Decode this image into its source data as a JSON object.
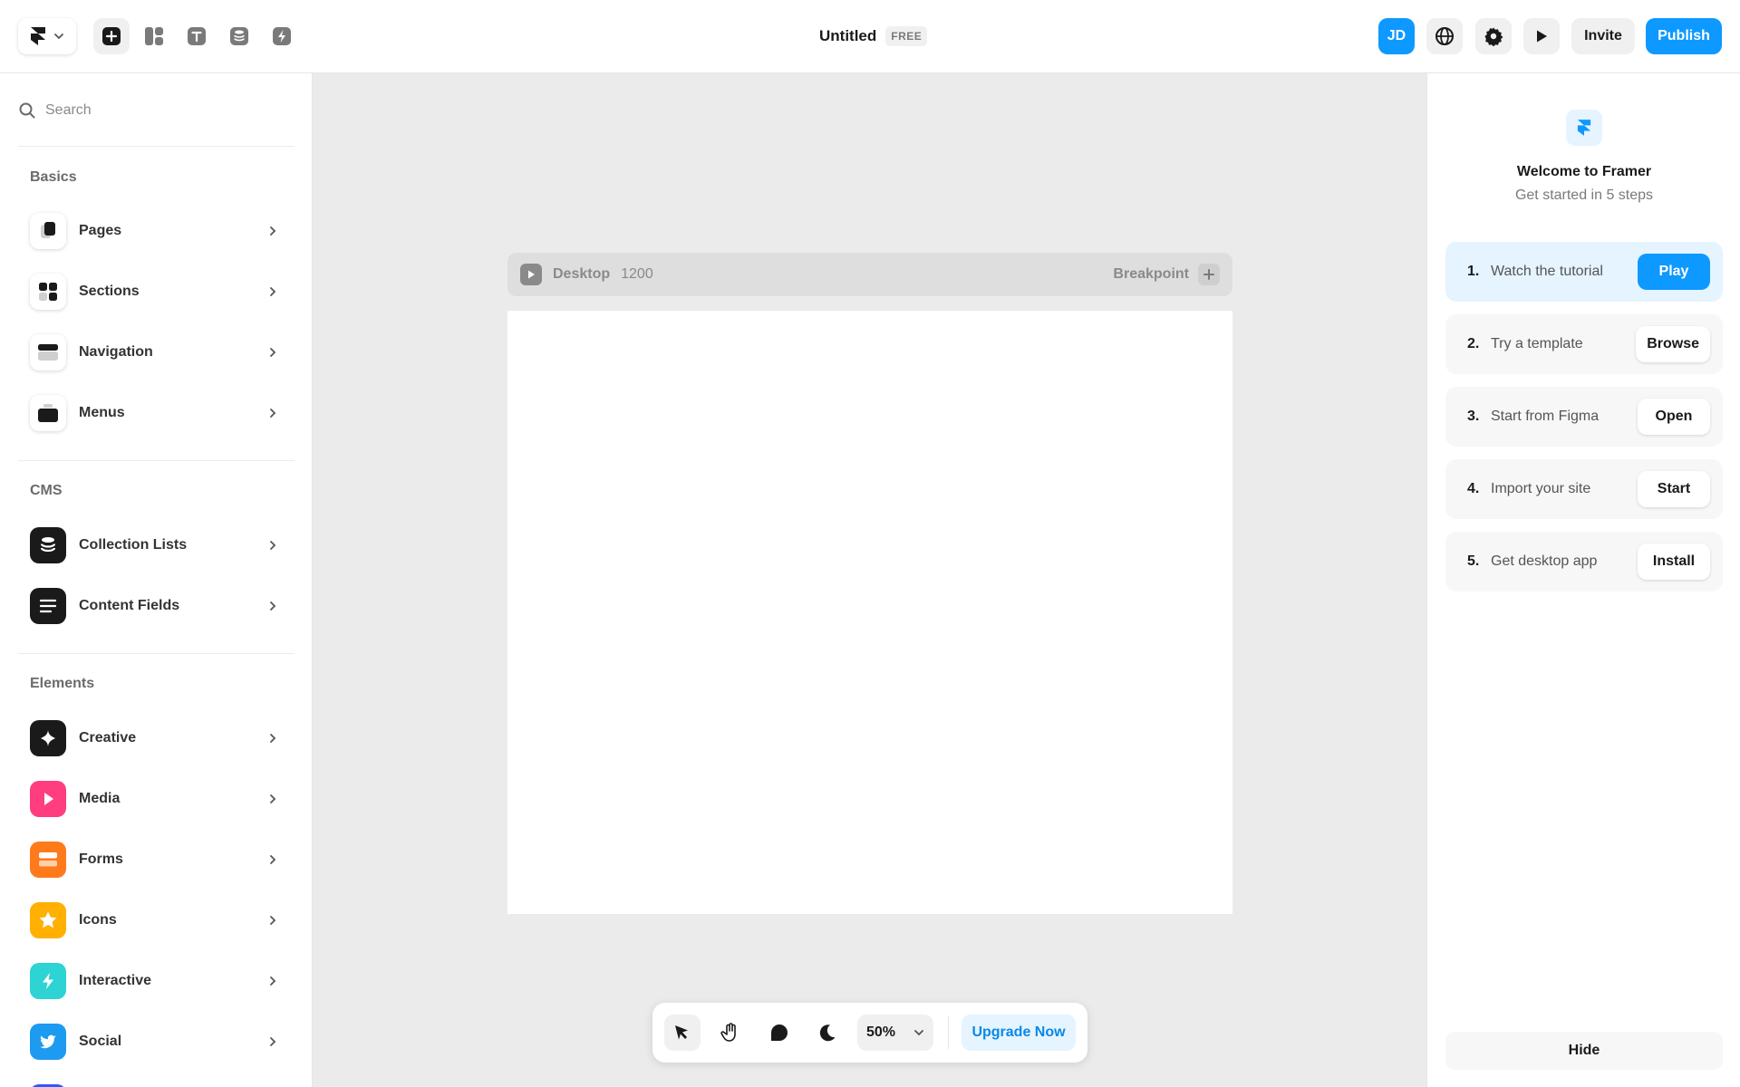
{
  "topbar": {
    "tools": [
      {
        "icon": "plus-icon"
      },
      {
        "icon": "layout-icon"
      },
      {
        "icon": "text-icon"
      },
      {
        "icon": "database-icon"
      },
      {
        "icon": "bolt-icon"
      }
    ],
    "doc_name": "Untitled",
    "plan_badge": "FREE",
    "avatar_initials": "JD",
    "invite_label": "Invite",
    "publish_label": "Publish"
  },
  "sidebar": {
    "search_placeholder": "Search",
    "basics_label": "Basics",
    "basics": [
      {
        "label": "Pages",
        "icon": "pages-icon"
      },
      {
        "label": "Sections",
        "icon": "sections-icon"
      },
      {
        "label": "Navigation",
        "icon": "navigation-icon"
      },
      {
        "label": "Menus",
        "icon": "menus-icon"
      }
    ],
    "cms_label": "CMS",
    "cms": [
      {
        "label": "Collection Lists",
        "icon": "database-icon"
      },
      {
        "label": "Content Fields",
        "icon": "text-lines-icon"
      }
    ],
    "elements_label": "Elements",
    "elements": [
      {
        "label": "Creative",
        "icon": "sparkle-icon",
        "color": "#1a1a1a"
      },
      {
        "label": "Media",
        "icon": "play-icon",
        "color": "#ff3d7f"
      },
      {
        "label": "Forms",
        "icon": "form-icon",
        "color": "#ff7a1a"
      },
      {
        "label": "Icons",
        "icon": "star-icon",
        "color": "#ffb000"
      },
      {
        "label": "Interactive",
        "icon": "bolt-icon",
        "color": "#2ed3d3"
      },
      {
        "label": "Social",
        "icon": "twitter-icon",
        "color": "#1d9bf0"
      }
    ]
  },
  "canvas": {
    "frame_name": "Desktop",
    "frame_width": "1200",
    "breakpoint_label": "Breakpoint",
    "zoom": "50%",
    "upgrade_label": "Upgrade Now"
  },
  "welcome": {
    "title": "Welcome to Framer",
    "subtitle": "Get started in 5 steps",
    "steps": [
      {
        "num": "1.",
        "text": "Watch the tutorial",
        "action": "Play"
      },
      {
        "num": "2.",
        "text": "Try a template",
        "action": "Browse"
      },
      {
        "num": "3.",
        "text": "Start from Figma",
        "action": "Open"
      },
      {
        "num": "4.",
        "text": "Import your site",
        "action": "Start"
      },
      {
        "num": "5.",
        "text": "Get desktop app",
        "action": "Install"
      }
    ],
    "hide_label": "Hide"
  },
  "colors": {
    "accent": "#0d99ff",
    "canvas_bg": "#ebebeb"
  }
}
